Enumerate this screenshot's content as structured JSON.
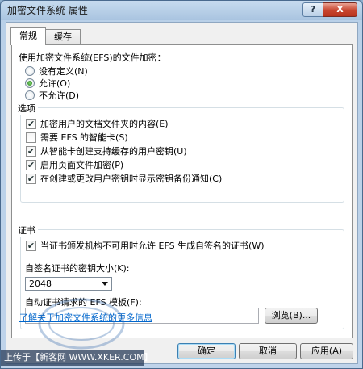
{
  "window": {
    "title": "加密文件系统 属性",
    "help_label": "?",
    "close_label": "X"
  },
  "tabs": [
    {
      "label": "常规",
      "active": true
    },
    {
      "label": "缓存",
      "active": false
    }
  ],
  "efs": {
    "prompt": "使用加密文件系统(EFS)的文件加密：",
    "options": [
      {
        "label": "没有定义(N)",
        "selected": false
      },
      {
        "label": "允许(O)",
        "selected": true
      },
      {
        "label": "不允许(D)",
        "selected": false
      }
    ]
  },
  "options_group": {
    "title": "选项",
    "items": [
      {
        "label": "加密用户的文档文件夹的内容(E)",
        "checked": true
      },
      {
        "label": "需要 EFS 的智能卡(S)",
        "checked": false
      },
      {
        "label": "从智能卡创建支持缓存的用户密钥(U)",
        "checked": true
      },
      {
        "label": "启用页面文件加密(P)",
        "checked": true
      },
      {
        "label": "在创建或更改用户密钥时显示密钥备份通知(C)",
        "checked": true
      }
    ]
  },
  "cert_group": {
    "title": "证书",
    "self_signed_label": "当证书颁发机构不可用时允许 EFS 生成自签名的证书(W)",
    "self_signed_checked": true,
    "key_size_label": "自签名证书的密钥大小(K):",
    "key_size_value": "2048",
    "template_label": "自动证书请求的 EFS 模板(F):",
    "template_value": "",
    "browse_label": "浏览(B)..."
  },
  "link_text": "了解关于加密文件系统的更多信息",
  "buttons": {
    "ok": "确定",
    "cancel": "取消",
    "apply": "应用(A)"
  },
  "watermark": {
    "text": "上传于【新客网 WWW.XKER.COM】",
    "seal_text": "新客网"
  },
  "colors": {
    "link": "#0066cc",
    "title_bar": "#a9c4e0",
    "close_button": "#c7452f"
  }
}
